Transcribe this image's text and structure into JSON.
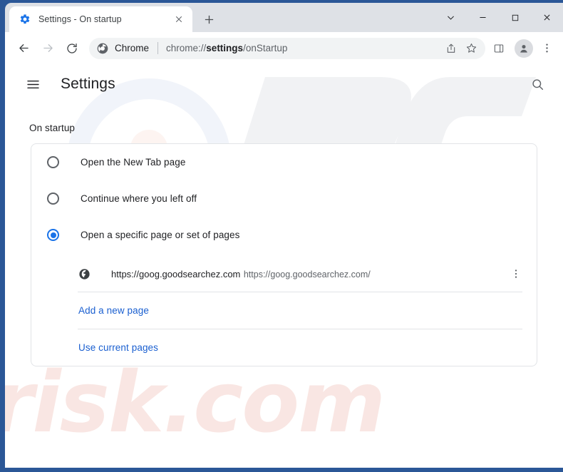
{
  "window": {
    "frame_color": "#2b5797",
    "controls": [
      {
        "name": "tab-search",
        "icon": "chevron-down-icon"
      },
      {
        "name": "minimize",
        "icon": "minimize-icon"
      },
      {
        "name": "maximize",
        "icon": "maximize-icon"
      },
      {
        "name": "close",
        "icon": "close-icon"
      }
    ]
  },
  "tabstrip": {
    "tabs": [
      {
        "title": "Settings - On startup",
        "favicon": "settings-gear-icon",
        "active": true
      }
    ],
    "new_tab_label": "+",
    "close_label": "×"
  },
  "toolbar": {
    "back_icon": "back-arrow-icon",
    "forward_icon": "forward-arrow-icon",
    "reload_icon": "reload-icon",
    "omnibox": {
      "product_icon": "chrome-logo-icon",
      "chip_label": "Chrome",
      "url_prefix": "chrome://",
      "url_bold": "settings",
      "url_suffix": "/onStartup",
      "full_url": "chrome://settings/onStartup",
      "share_icon": "share-icon",
      "bookmark_icon": "star-icon"
    },
    "side_panel_icon": "side-panel-icon",
    "profile_icon": "profile-avatar-icon",
    "menu_icon": "three-dot-menu-icon"
  },
  "settings": {
    "menu_icon": "hamburger-menu-icon",
    "title": "Settings",
    "search_icon": "search-icon",
    "section_title": "On startup",
    "startup_options": [
      {
        "label": "Open the New Tab page",
        "selected": false
      },
      {
        "label": "Continue where you left off",
        "selected": false
      },
      {
        "label": "Open a specific page or set of pages",
        "selected": true
      }
    ],
    "startup_pages": [
      {
        "favicon": "globe-icon",
        "title": "https://goog.goodsearchez.com",
        "subtitle": "https://goog.goodsearchez.com/",
        "more_icon": "three-dot-menu-icon"
      }
    ],
    "add_page_link": "Add a new page",
    "use_current_link": "Use current pages",
    "link_color": "#1a5fd0",
    "accent_color": "#1a73e8"
  },
  "watermark": {
    "text": "risk.com",
    "logo": "PC"
  }
}
